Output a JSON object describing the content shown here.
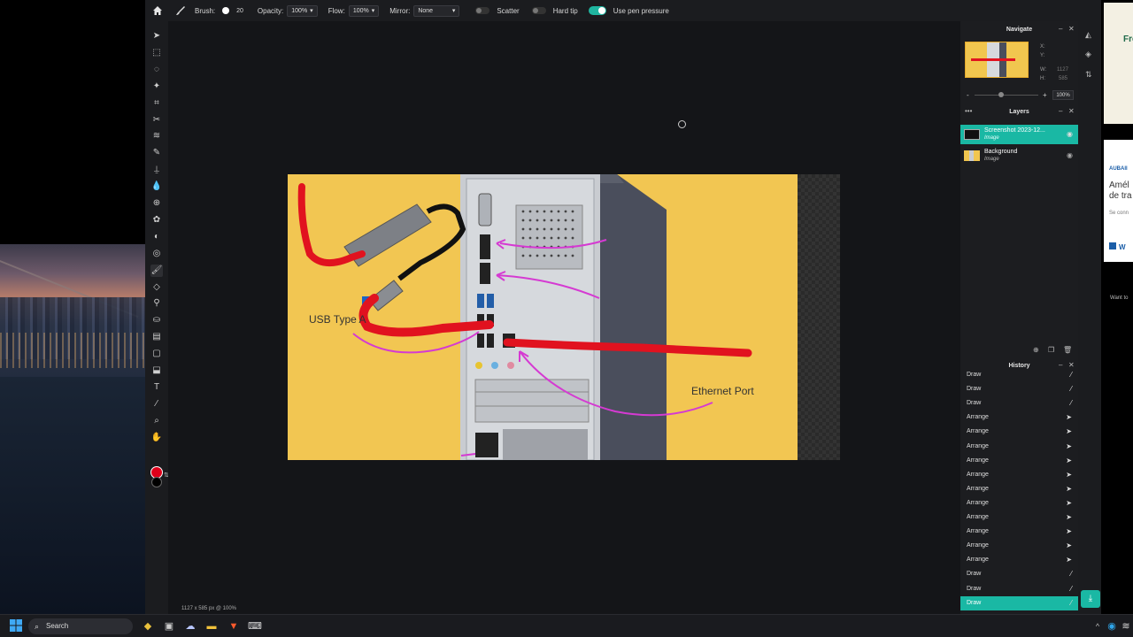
{
  "toolbar_top": {
    "brush_label": "Brush:",
    "brush_size": "20",
    "opacity_label": "Opacity:",
    "opacity_value": "100%",
    "flow_label": "Flow:",
    "flow_value": "100%",
    "mirror_label": "Mirror:",
    "mirror_value": "None",
    "scatter_label": "Scatter",
    "hard_tip_label": "Hard tip",
    "pen_pressure_label": "Use pen pressure"
  },
  "tools": [
    "move-tool",
    "select-rect-tool",
    "lasso-tool",
    "magic-wand-tool",
    "crop-tool",
    "cut-tool",
    "liquify-tool",
    "pencil-tool",
    "clone-stamp-tool",
    "blur-tool",
    "sponge-tool",
    "heal-tool",
    "dodge-tool",
    "smudge-tool",
    "brush-tool",
    "eraser-tool",
    "color-replace-tool",
    "paint-bucket-tool",
    "gradient-tool",
    "shape-tool",
    "stamp-tool",
    "text-tool",
    "eyedropper-tool",
    "zoom-tool",
    "hand-tool"
  ],
  "colors": {
    "primary": "#e0001a",
    "secondary": "#000000",
    "accent": "#1ab8a4"
  },
  "image": {
    "label_usb": "USB Type A",
    "label_ethernet": "Ethernet Port"
  },
  "status": {
    "size_text": "1127 x 585 px @ 100%"
  },
  "navigate": {
    "title": "Navigate",
    "x_label": "X:",
    "y_label": "Y:",
    "w_label": "W:",
    "w_value": "1127",
    "h_label": "H:",
    "h_value": "585",
    "zoom_value": "100%"
  },
  "layers": {
    "title": "Layers",
    "items": [
      {
        "name": "Screenshot 2023-12...",
        "type": "Image"
      },
      {
        "name": "Background",
        "type": "Image"
      }
    ]
  },
  "history": {
    "title": "History",
    "items": [
      "Draw",
      "Draw",
      "Draw",
      "Arrange",
      "Arrange",
      "Arrange",
      "Arrange",
      "Arrange",
      "Arrange",
      "Arrange",
      "Arrange",
      "Arrange",
      "Arrange",
      "Arrange",
      "Draw",
      "Draw",
      "Draw"
    ]
  },
  "site": {
    "ad1_text": "Fre",
    "ad2_a": "AUBAII",
    "ad2_b1": "Amél",
    "ad2_b2": "de tra",
    "ad2_c": "Se conn",
    "ad2_w": "W",
    "want_text": "Want to"
  },
  "taskbar": {
    "search_label": "Search"
  }
}
